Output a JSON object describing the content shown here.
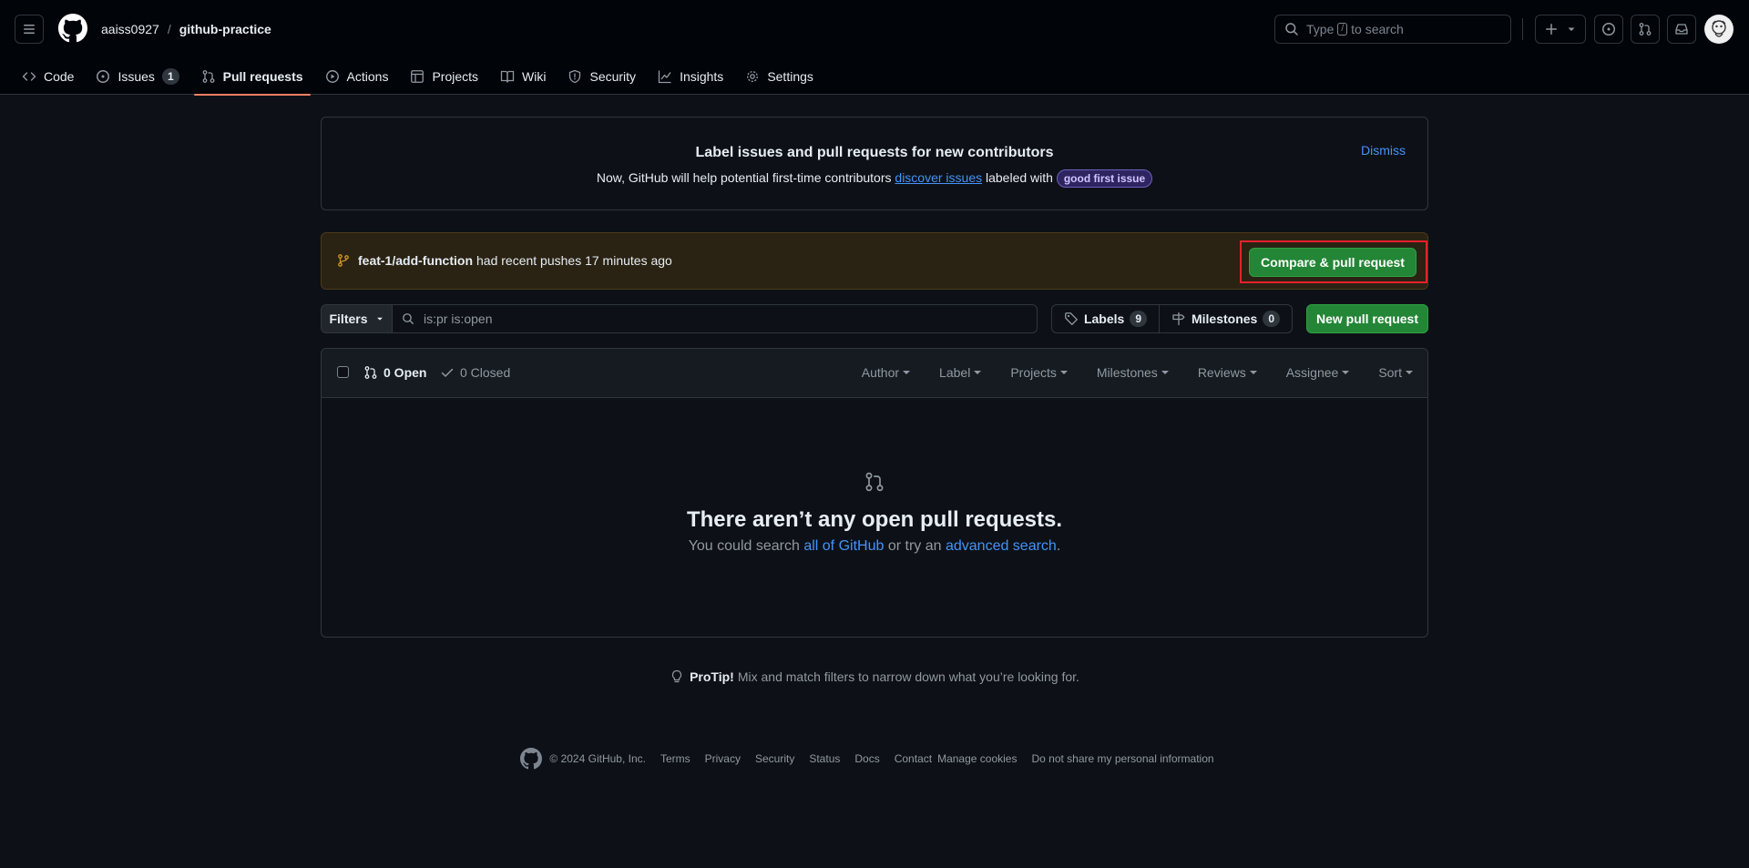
{
  "header": {
    "owner": "aaiss0927",
    "separator": "/",
    "repo": "github-practice",
    "search_prefix": "Type",
    "search_key": "/",
    "search_suffix": "to search"
  },
  "repo_nav": [
    {
      "label": "Code",
      "icon": "code-icon"
    },
    {
      "label": "Issues",
      "icon": "issue-opened-icon",
      "count": "1"
    },
    {
      "label": "Pull requests",
      "icon": "git-pull-request-icon",
      "active": true
    },
    {
      "label": "Actions",
      "icon": "play-icon"
    },
    {
      "label": "Projects",
      "icon": "table-icon"
    },
    {
      "label": "Wiki",
      "icon": "book-icon"
    },
    {
      "label": "Security",
      "icon": "shield-icon"
    },
    {
      "label": "Insights",
      "icon": "graph-icon"
    },
    {
      "label": "Settings",
      "icon": "gear-icon"
    }
  ],
  "banner": {
    "title": "Label issues and pull requests for new contributors",
    "body_prefix": "Now, GitHub will help potential first-time contributors",
    "body_link": "discover issues",
    "body_mid": "labeled with",
    "label": "good first issue",
    "dismiss": "Dismiss"
  },
  "push": {
    "branch": "feat-1/add-function",
    "message": "had recent pushes 17 minutes ago",
    "button": "Compare & pull request"
  },
  "filters": {
    "button": "Filters",
    "query": "is:pr is:open",
    "labels": "Labels",
    "labels_count": "9",
    "milestones": "Milestones",
    "milestones_count": "0",
    "new_pr": "New pull request"
  },
  "list": {
    "open": "0 Open",
    "closed": "0 Closed",
    "sort_items": [
      "Author",
      "Label",
      "Projects",
      "Milestones",
      "Reviews",
      "Assignee",
      "Sort"
    ],
    "empty_title": "There aren’t any open pull requests.",
    "empty_prefix": "You could search",
    "empty_link1": "all of GitHub",
    "empty_mid": "or try an",
    "empty_link2": "advanced search",
    "empty_suffix": "."
  },
  "protip": {
    "bold": "ProTip!",
    "text": "Mix and match filters to narrow down what you’re looking for."
  },
  "footer": {
    "copyright": "© 2024 GitHub, Inc.",
    "links": [
      "Terms",
      "Privacy",
      "Security",
      "Status",
      "Docs",
      "Contact",
      "Manage cookies",
      "Do not share my personal information"
    ]
  },
  "colors": {
    "background": "#0d1117",
    "header_bg": "#010409",
    "accent_link": "#4493f8",
    "primary_button": "#238636",
    "active_tab_underline": "#f78166",
    "highlight_outline": "#e5212c"
  }
}
